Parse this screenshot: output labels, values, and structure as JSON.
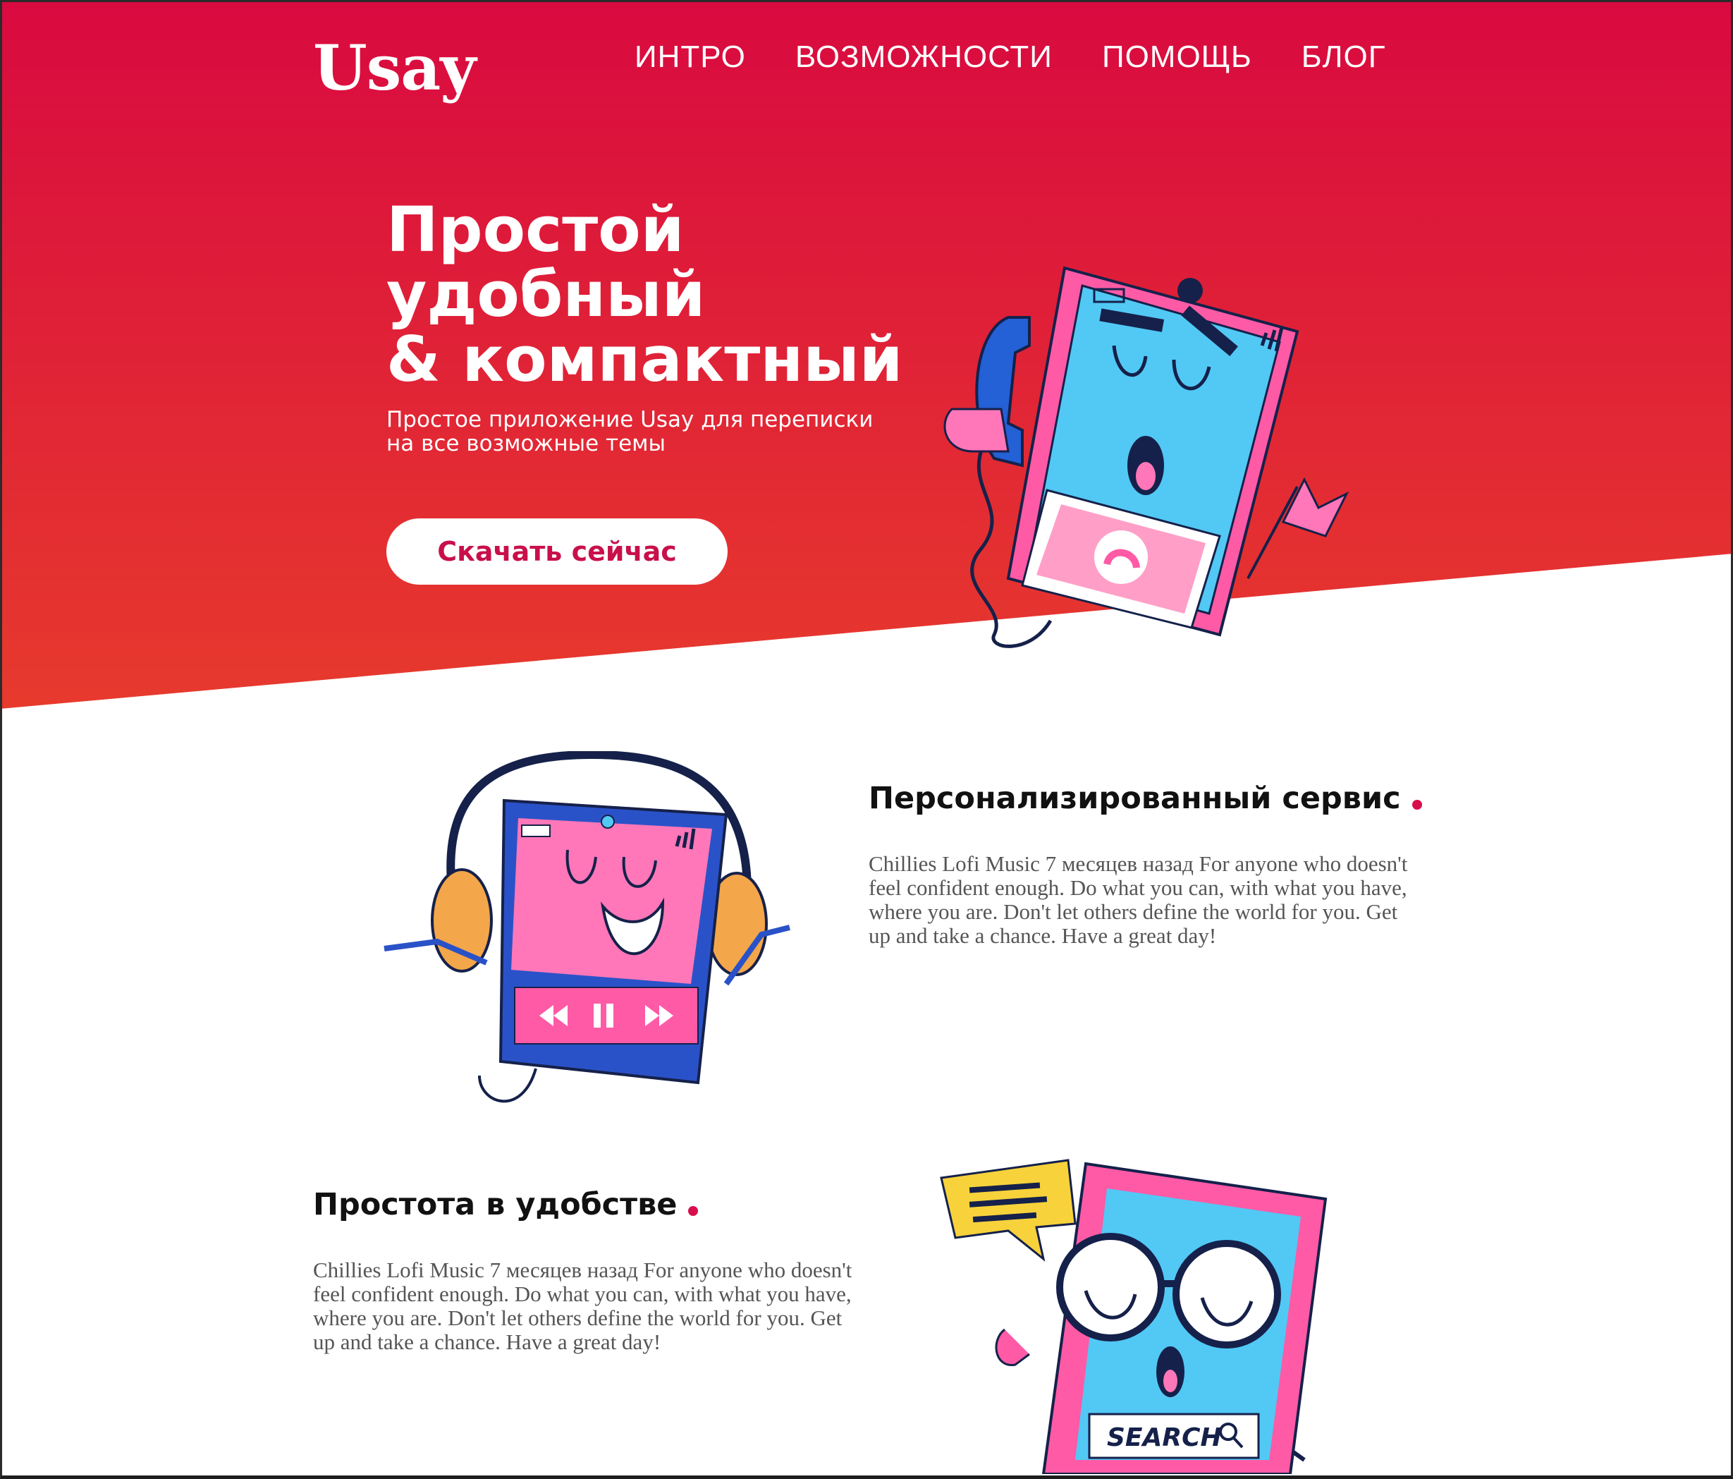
{
  "colors": {
    "hero_top": "#d90a40",
    "hero_bottom": "#e73a2d",
    "accent": "#d80f4b",
    "white": "#ffffff"
  },
  "header": {
    "logo": "Usay",
    "nav": [
      "ИНТРО",
      "ВОЗМОЖНОСТИ",
      "ПОМОЩЬ",
      "БЛОГ"
    ]
  },
  "hero": {
    "title_lines": [
      "Простой",
      "удобный",
      "& компактный"
    ],
    "subtitle_line1": "Простое приложение Usay для переписки",
    "subtitle_line2": "на все возможные темы",
    "cta_label": "Скачать сейчас",
    "illustration": "phone-calling-character"
  },
  "features": [
    {
      "title": "Персонализированный сервис",
      "text": "Chillies Lofi Music 7 месяцев назад For anyone who doesn't feel confident enough. Do what you can, with what you have, where you are. Don't let others define the world for you. Get up and take a chance. Have a great day!",
      "illustration": "phone-headphones-character"
    },
    {
      "title": "Простота в удобстве",
      "text": "Chillies Lofi Music 7 месяцев назад For anyone who doesn't feel confident enough. Do what you can, with what you have, where you are. Don't let others define the world for you. Get up and take a chance. Have a great day!",
      "illustration": "phone-search-character",
      "search_label": "SEARCH"
    }
  ]
}
